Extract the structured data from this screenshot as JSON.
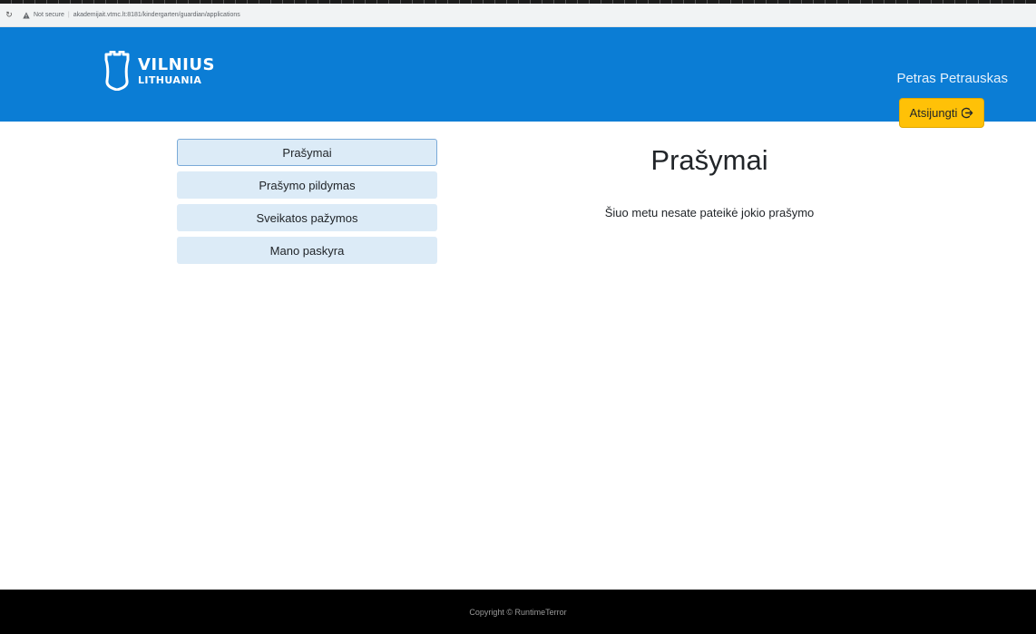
{
  "browser": {
    "reload_icon": "reload-icon",
    "security_icon": "warning-triangle-icon",
    "security_text": "Not secure",
    "url": "akademijait.vtmc.lt:8181/kindergarten/guardian/applications"
  },
  "header": {
    "logo_line1": "VILNIUS",
    "logo_line2": "LITHUANIA",
    "user_name": "Petras Petrauskas",
    "logout_label": "Atsijungti",
    "logout_icon": "logout-arrow-icon",
    "bg_color": "#0b7dd5",
    "logout_color": "#ffc107"
  },
  "sidebar": {
    "items": [
      {
        "label": "Prašymai",
        "active": true
      },
      {
        "label": "Prašymo pildymas",
        "active": false
      },
      {
        "label": "Sveikatos pažymos",
        "active": false
      },
      {
        "label": "Mano paskyra",
        "active": false
      }
    ]
  },
  "main": {
    "title": "Prašymai",
    "empty_message": "Šiuo metu nesate pateikė jokio prašymo"
  },
  "footer": {
    "copyright": "Copyright © RuntimeTerror"
  }
}
